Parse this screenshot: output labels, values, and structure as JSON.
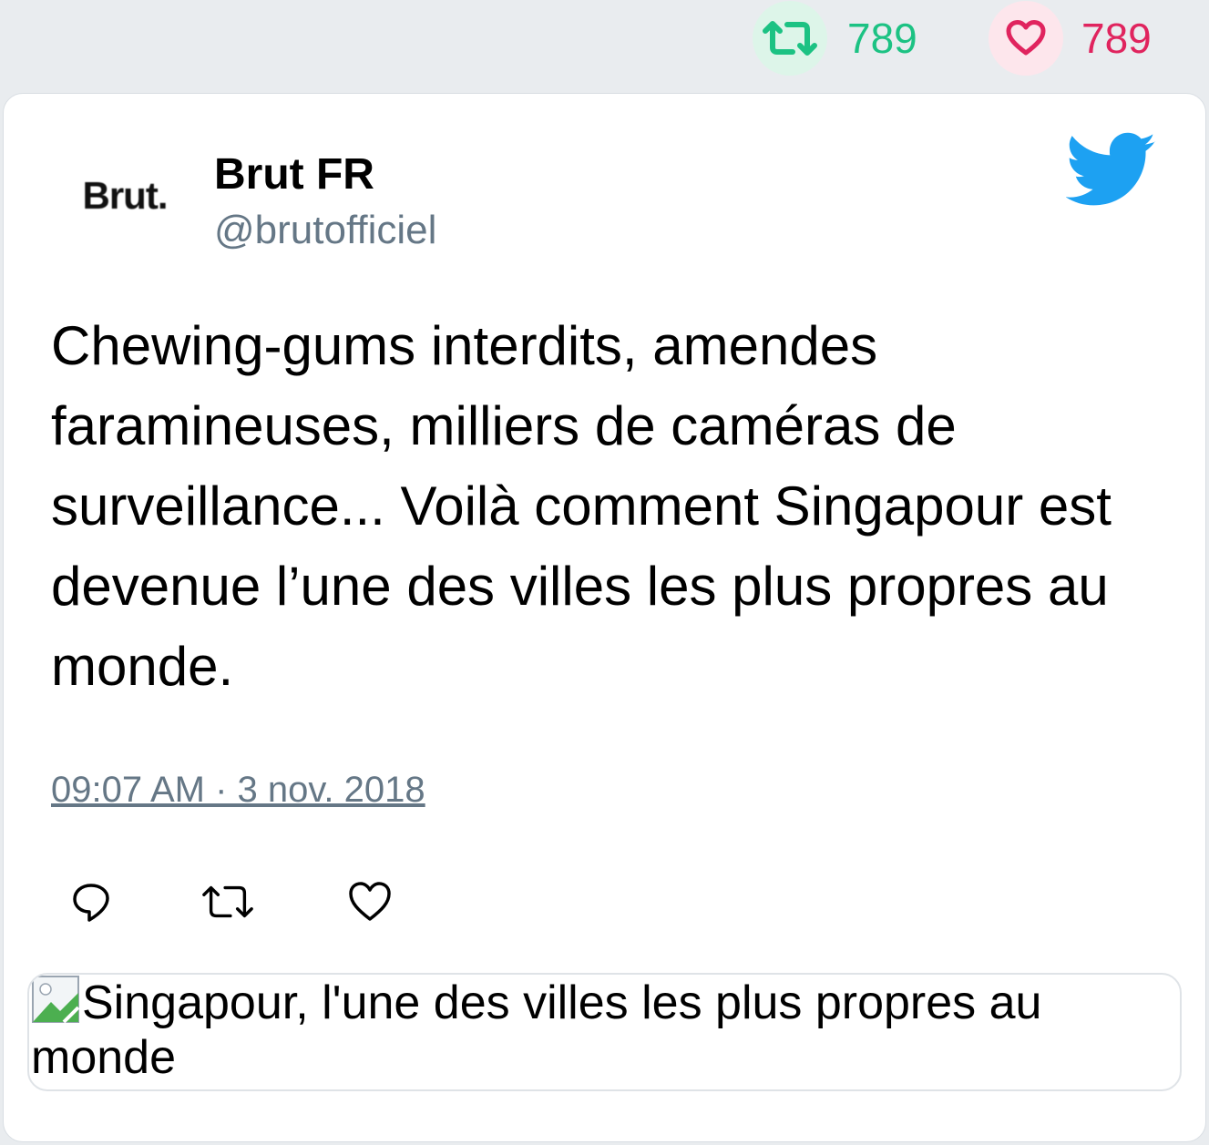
{
  "stats": {
    "retweets": "789",
    "likes": "789",
    "retweet_icon": "retweet-icon",
    "like_icon": "heart-icon",
    "retweet_color": "#1cc283",
    "like_color": "#e0245e"
  },
  "tweet": {
    "avatar_text": "Brut.",
    "author_name": "Brut FR",
    "author_handle": "@brutofficiel",
    "text": "Chewing-gums interdits, amendes faramineuses, milliers de caméras de surveillance... Voilà comment Singapour est devenue l’une des villes les plus propres au monde.",
    "timestamp": "09:07 AM · 3 nov. 2018",
    "brand_icon": "twitter-bird-icon",
    "brand_color": "#1da1f2"
  },
  "actions": {
    "reply_icon": "reply-icon",
    "retweet_icon": "retweet-icon",
    "like_icon": "heart-icon"
  },
  "media": {
    "alt_text": "Singapour, l'une des villes les plus propres au monde"
  }
}
